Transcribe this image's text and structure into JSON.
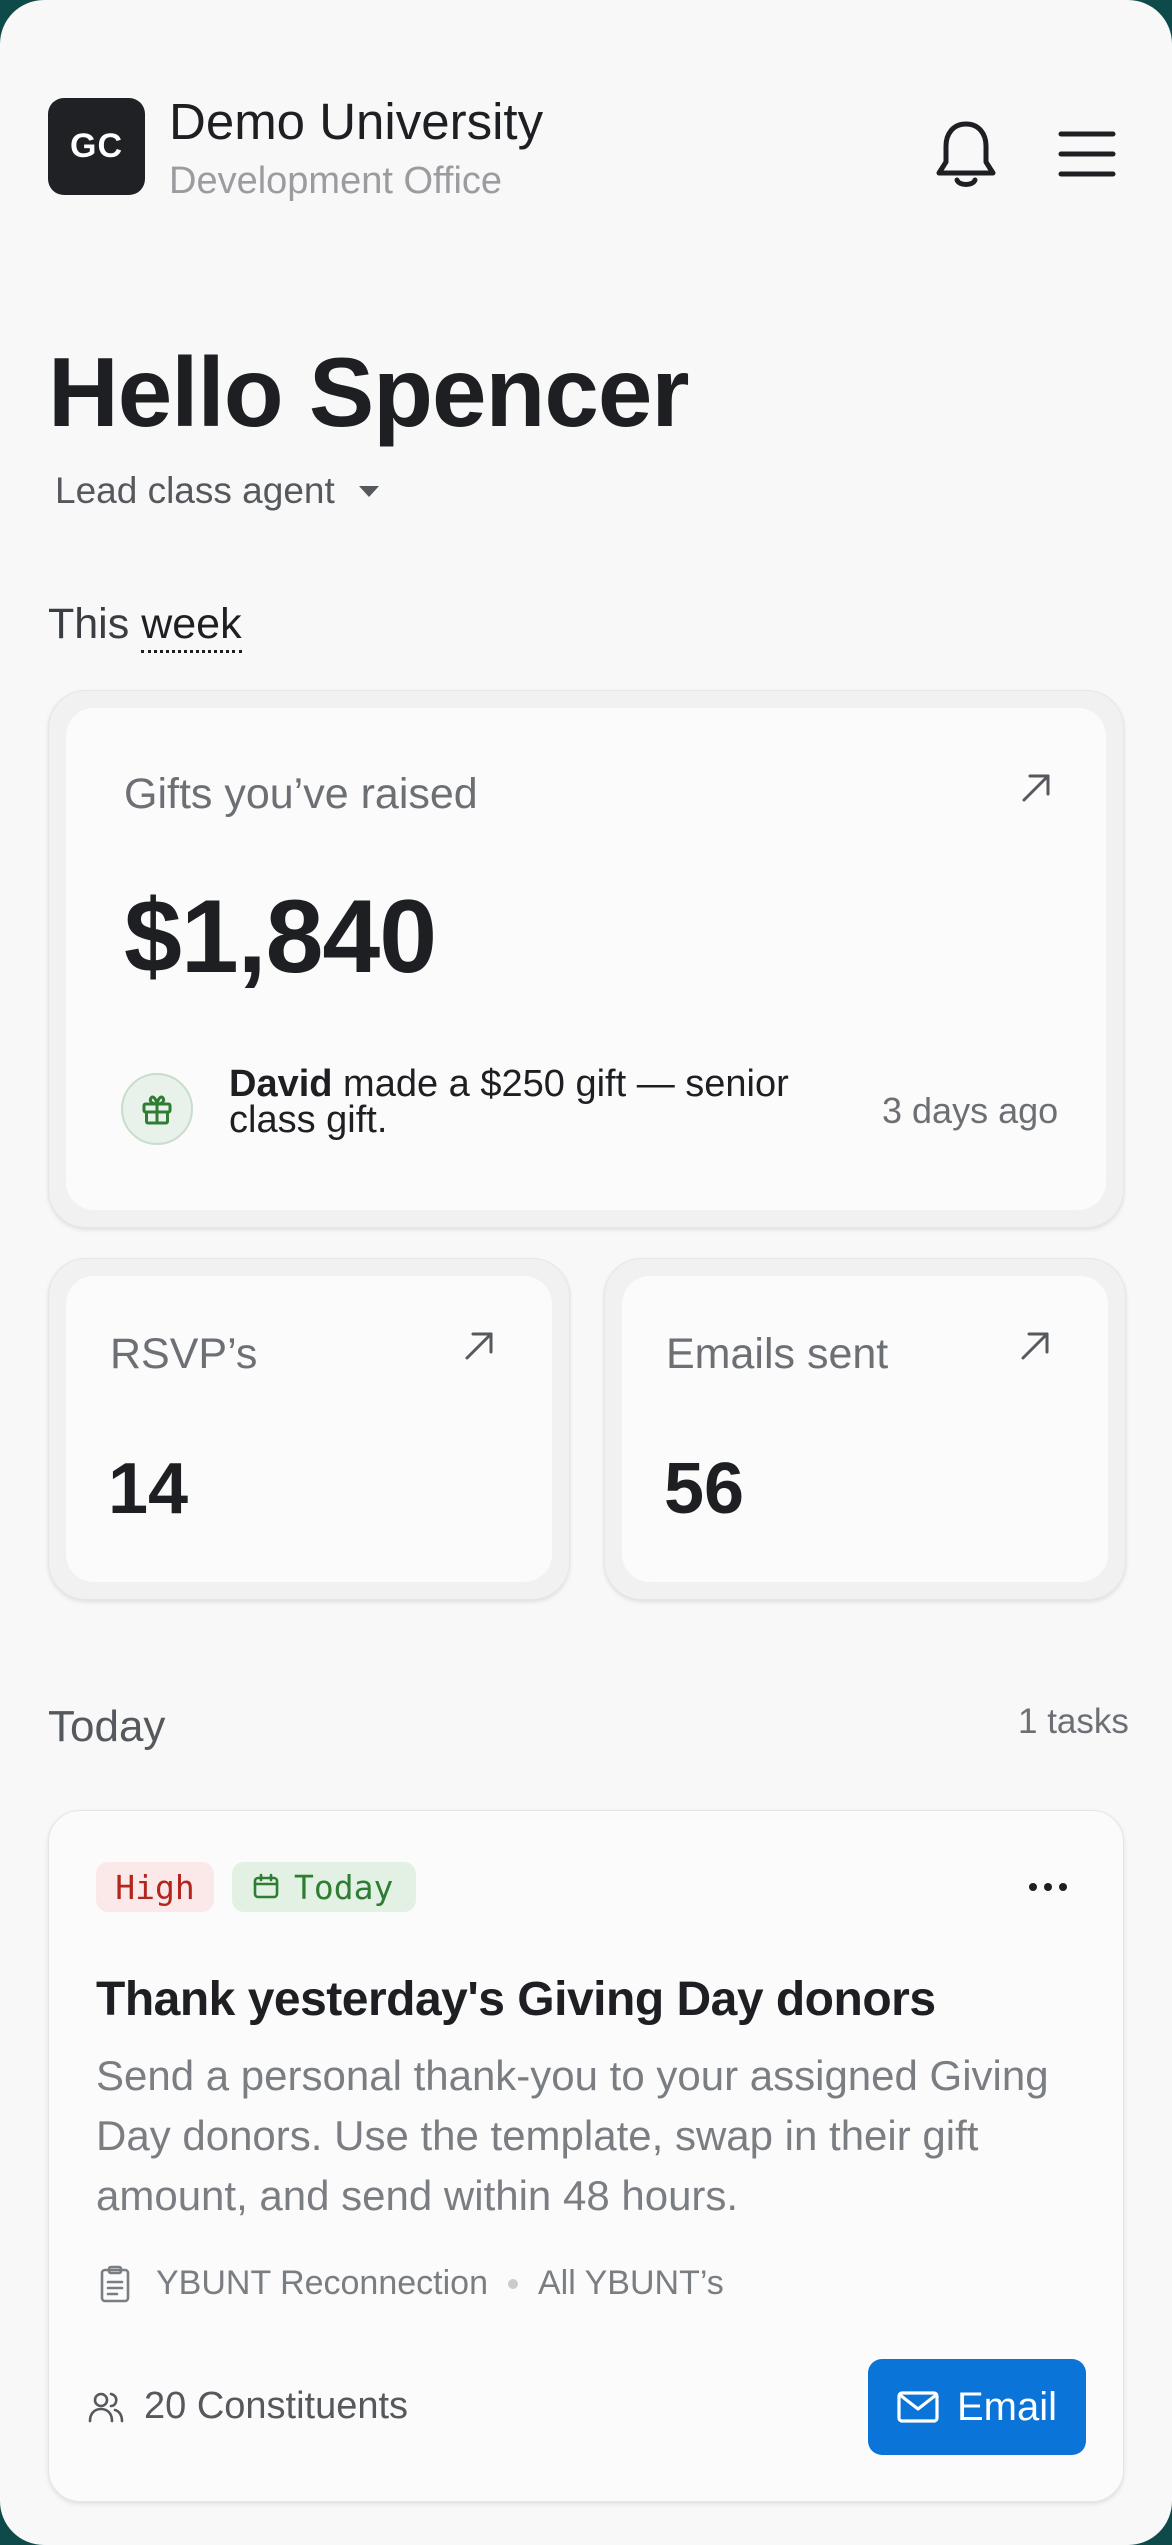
{
  "header": {
    "logo_initials": "GC",
    "org_name": "Demo University",
    "org_subtitle": "Development Office",
    "icons": [
      "bell-icon",
      "hamburger-menu-icon"
    ]
  },
  "greeting": "Hello Spencer",
  "role_selector": {
    "value": "Lead class agent"
  },
  "period": {
    "prefix": "This",
    "value": "week"
  },
  "gifts_card": {
    "title": "Gifts you’ve raised",
    "amount": "$1,840",
    "activity": {
      "name": "David",
      "text": " made a $250 gift — senior class gift.",
      "time": "3 days ago"
    }
  },
  "stats": [
    {
      "label": "RSVP’s",
      "value": "14"
    },
    {
      "label": "Emails sent",
      "value": "56"
    }
  ],
  "today": {
    "heading": "Today",
    "count": "1 tasks"
  },
  "task": {
    "priority": "High",
    "due": "Today",
    "title": "Thank yesterday's Giving Day donors",
    "description": "Send a personal thank-you to your assigned Giving Day donors. Use the template, swap in their gift amount, and send within 48 hours.",
    "campaign": "YBUNT Reconnection",
    "audience": "All YBUNT’s",
    "constituents": "20 Constituents",
    "action_label": "Email"
  },
  "colors": {
    "accent_blue": "#0a74d9",
    "high_badge_bg": "#fbe9ea",
    "high_badge_text": "#b3261e",
    "today_badge_bg": "#e3f1e5",
    "today_badge_text": "#2e7d32",
    "frame": "#0e4a4a"
  }
}
